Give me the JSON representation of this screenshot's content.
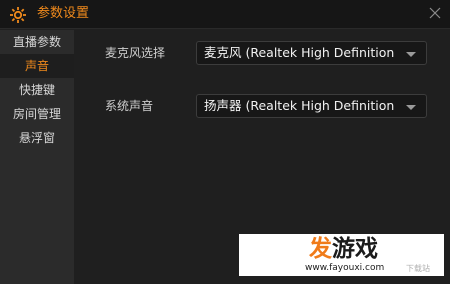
{
  "window": {
    "title": "参数设置",
    "accent_color": "#f08a1c",
    "icons": {
      "app": "gear-icon",
      "close": "close-icon",
      "dropdown": "chevron-down-icon"
    }
  },
  "sidebar": {
    "items": [
      {
        "label": "直播参数",
        "active": false
      },
      {
        "label": "声音",
        "active": true
      },
      {
        "label": "快捷键",
        "active": false
      },
      {
        "label": "房间管理",
        "active": false
      },
      {
        "label": "悬浮窗",
        "active": false
      }
    ]
  },
  "audio": {
    "mic_label": "麦克风选择",
    "mic_value": "麦克风 (Realtek High Definition",
    "system_label": "系统声音",
    "system_value": "扬声器 (Realtek High Definition"
  },
  "watermark": {
    "logo_first": "发",
    "logo_rest": "游戏",
    "url": "www.fayouxi.com",
    "faded": "下载站"
  }
}
